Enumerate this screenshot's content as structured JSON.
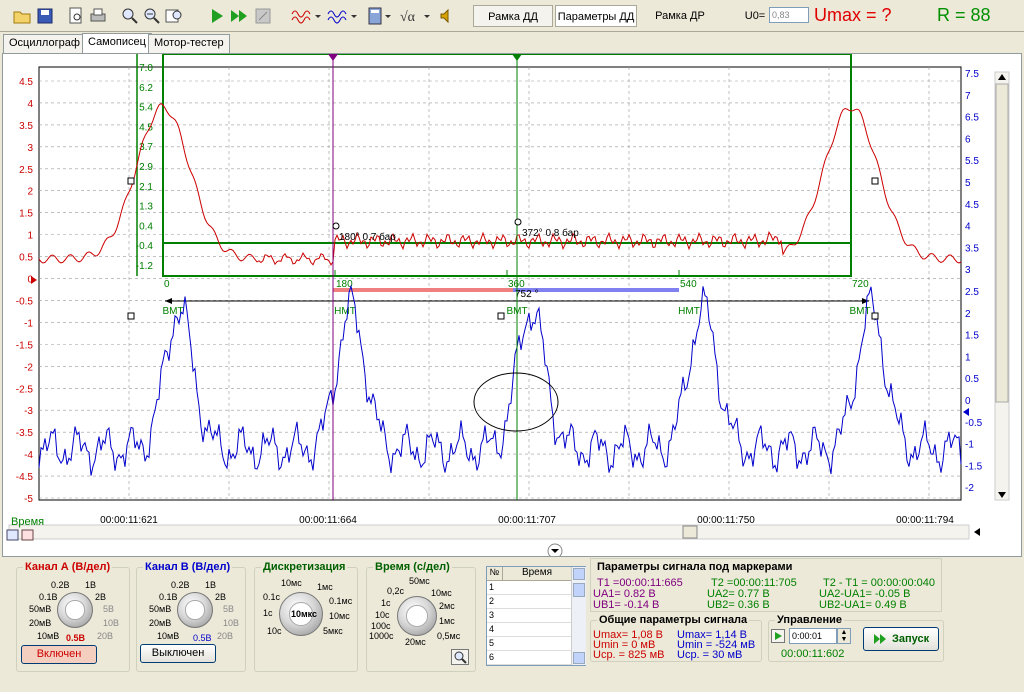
{
  "toolbar": {
    "frame_dd": "Рамка ДД",
    "params_dd": "Параметры ДД",
    "frame_dr": "Рамка ДР",
    "u0_label": "U0=",
    "u0_value": "0,83",
    "umax_label": "Umax = ?",
    "r_label": "R = 88",
    "icons": [
      "open-folder-icon",
      "save-icon",
      "preview-icon",
      "print-icon",
      "zoom-icon",
      "zoom-out-icon",
      "zoom-window-icon",
      "play-icon",
      "fast-forward-icon",
      "stop-icon",
      "wave-red-icon",
      "wave-blue-icon",
      "calculator-icon",
      "sqrt-icon",
      "speaker-icon"
    ]
  },
  "tabs": [
    "Осциллограф",
    "Самописец",
    "Мотор-тестер"
  ],
  "active_tab": 1,
  "plot": {
    "left_axis_ticks": [
      "4.5",
      "4",
      "3.5",
      "3",
      "2.5",
      "2",
      "1.5",
      "1",
      "0.5",
      "0",
      "-0.5",
      "-1",
      "-1.5",
      "-2",
      "-2.5",
      "-3",
      "-3.5",
      "-4",
      "-4.5",
      "-5"
    ],
    "right_axis_ticks": [
      "7.5",
      "7",
      "6.5",
      "6",
      "5.5",
      "5",
      "4.5",
      "4",
      "3.5",
      "3",
      "2.5",
      "2",
      "1.5",
      "1",
      "0.5",
      "0",
      "-0.5",
      "-1",
      "-1.5",
      "-2"
    ],
    "inner_axis_ticks": [
      "7.0",
      "6.2",
      "5.4",
      "4.5",
      "3.7",
      "2.9",
      "2.1",
      "1.3",
      "0.4",
      "-0.4",
      "-1.2"
    ],
    "angle_ticks": [
      "0",
      "180",
      "360",
      "540",
      "720"
    ],
    "span_label": "752 °",
    "tdc_labels": [
      "ВМТ",
      "НМТ",
      "ВМТ",
      "НМТ",
      "ВМТ"
    ],
    "marker1_text": "180° 0.7 бар",
    "marker2_text": "372° 0.8 бар",
    "x_axis_label": "Время",
    "time_ticks": [
      "00:00:11:621",
      "00:00:11:664",
      "00:00:11:707",
      "00:00:11:750",
      "00:00:11:794"
    ]
  },
  "channel_a": {
    "title": "Канал А (В/дел)",
    "labels": [
      "0.2В",
      "1В",
      "0.1В",
      "2В",
      "50мВ",
      "5В",
      "20мВ",
      "10В",
      "10мВ",
      "20В"
    ],
    "value": "0.5В",
    "button": "Включен"
  },
  "channel_b": {
    "title": "Канал В (В/дел)",
    "labels": [
      "0.2В",
      "1В",
      "0.1В",
      "2В",
      "50мВ",
      "5В",
      "20мВ",
      "10В",
      "10мВ",
      "20В"
    ],
    "value": "0.5В",
    "button": "Выключен"
  },
  "sampling": {
    "title": "Дискретизация",
    "labels": [
      "10мс",
      "1мс",
      "0.1с",
      "0.1мс",
      "1с",
      "10мс",
      "10с",
      "5мкс"
    ],
    "value": "10мкс"
  },
  "time": {
    "title": "Время (с/дел)",
    "labels": [
      "50мс",
      "0,2с",
      "10мс",
      "1с",
      "2мс",
      "10с",
      "100с",
      "1мс",
      "1000с",
      "0,5мс",
      "20мс"
    ]
  },
  "table": {
    "col_n": "№",
    "col_time": "Время",
    "rows": [
      "1",
      "2",
      "3",
      "4",
      "5",
      "6"
    ]
  },
  "marker_params": {
    "title": "Параметры сигнала под маркерами",
    "t1": "T1 =00:00:11:665",
    "t2": "T2 =00:00:11:705",
    "dt": "T2 - T1 = 00:00:00:040",
    "ua1": "UA1= 0.82 В",
    "ua2": "UA2= 0.77 В",
    "dua": "UA2-UA1= -0.05 В",
    "ub1": "UB1= -0.14 В",
    "ub2": "UB2= 0.36 В",
    "dub": "UB2-UA1= 0.49 В"
  },
  "general_params": {
    "title": "Общие параметры сигнала",
    "umax_a": "Umax= 1,08 В",
    "umin_a": "Umin = 0 мВ",
    "uavg_a": "Uср. = 825 мВ",
    "umax_b": "Umax= 1,14 В",
    "umin_b": "Umin = -524 мВ",
    "uavg_b": "Uср. = 30 мВ"
  },
  "control": {
    "title": "Управление",
    "time_value": "0:00:01",
    "start_label": "Запуск",
    "clock": "00:00:11:602"
  },
  "colors": {
    "red": "#cc0000",
    "blue": "#0000cc",
    "green": "#008000",
    "purple": "#800080"
  }
}
